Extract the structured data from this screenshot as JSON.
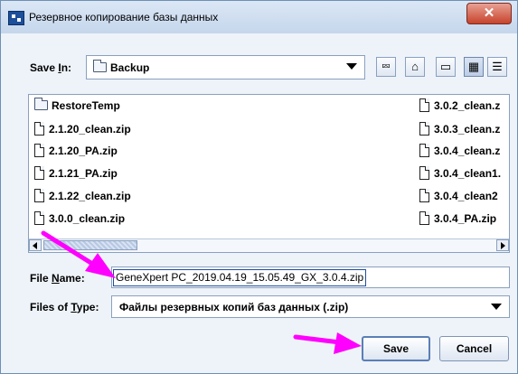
{
  "window": {
    "title": "Резервное копирование базы данных",
    "close_icon": "close-icon",
    "colors": {
      "close": "#c7432c",
      "arrow": "#ff00ff"
    }
  },
  "save_in": {
    "label_pre": "Save ",
    "label_key": "I",
    "label_post": "n:",
    "selected": "Backup",
    "icon": "folder-icon"
  },
  "toolbar": {
    "buttons": [
      {
        "name": "up-one-level-icon",
        "glyph": "⮹"
      },
      {
        "name": "home-icon",
        "glyph": "⌂"
      },
      {
        "name": "new-folder-icon",
        "glyph": "▭"
      },
      {
        "name": "list-view-icon",
        "glyph": "▦"
      },
      {
        "name": "details-view-icon",
        "glyph": "☰"
      }
    ]
  },
  "files": {
    "column1": [
      {
        "name": "RestoreTemp",
        "type": "folder"
      },
      {
        "name": "2.1.20_clean.zip",
        "type": "file"
      },
      {
        "name": "2.1.20_PA.zip",
        "type": "file"
      },
      {
        "name": "2.1.21_PA.zip",
        "type": "file"
      },
      {
        "name": "2.1.22_clean.zip",
        "type": "file"
      },
      {
        "name": "3.0.0_clean.zip",
        "type": "file"
      }
    ],
    "column2": [
      {
        "name": "3.0.2_clean.z",
        "type": "file"
      },
      {
        "name": "3.0.3_clean.z",
        "type": "file"
      },
      {
        "name": "3.0.4_clean.z",
        "type": "file"
      },
      {
        "name": "3.0.4_clean1.",
        "type": "file"
      },
      {
        "name": "3.0.4_clean2",
        "type": "file"
      },
      {
        "name": "3.0.4_PA.zip",
        "type": "file"
      }
    ]
  },
  "file_name": {
    "label_pre": "File ",
    "label_key": "N",
    "label_post": "ame:",
    "value": "GeneXpert PC_2019.04.19_15.05.49_GX_3.0.4.zip"
  },
  "file_type": {
    "label_pre": "Files of ",
    "label_key": "T",
    "label_post": "ype:",
    "value": "Файлы резервных копий баз данных (.zip)"
  },
  "buttons": {
    "save": "Save",
    "cancel": "Cancel"
  }
}
